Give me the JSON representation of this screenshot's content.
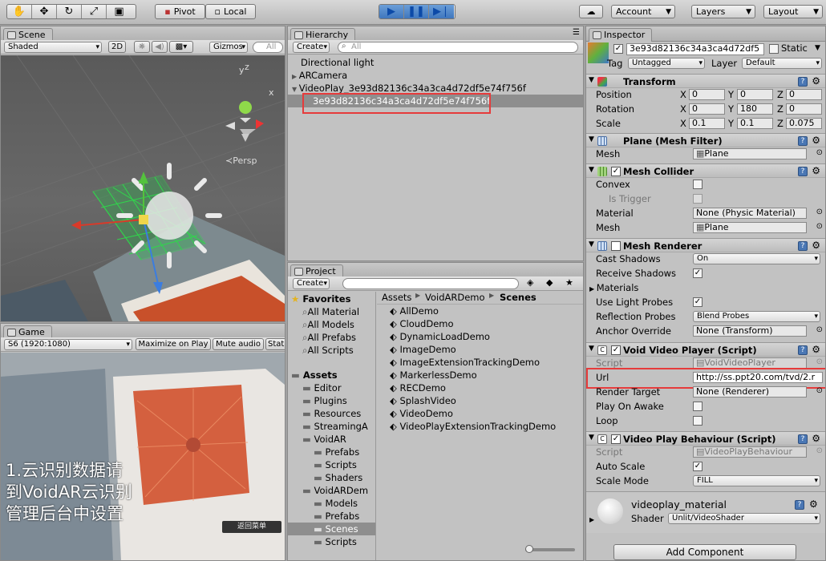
{
  "toolbar": {
    "pivot_label": "Pivot",
    "local_label": "Local",
    "account_label": "Account",
    "layers_label": "Layers",
    "layout_label": "Layout"
  },
  "scene": {
    "tab_label": "Scene",
    "shading_mode": "Shaded",
    "mode_2d": "2D",
    "gizmos_label": "Gizmos",
    "search_placeholder": "All",
    "persp_label": "Persp",
    "gizmo_y": "y",
    "gizmo_z": "z",
    "gizmo_x": "x"
  },
  "game": {
    "tab_label": "Game",
    "resolution": "S6 (1920:1080)",
    "maximize_label": "Maximize on Play",
    "mute_label": "Mute audio",
    "stats_label": "Stat",
    "overlay_line1": "1.云识别数据请",
    "overlay_line2": "到VoidAR云识别",
    "overlay_line3": "管理后台中设置",
    "phone_button": "返回菜单"
  },
  "hierarchy": {
    "tab_label": "Hierarchy",
    "create_label": "Create",
    "search_placeholder": "All",
    "items": [
      {
        "label": "Directional light"
      },
      {
        "label": "ARCamera"
      },
      {
        "label": "VideoPlay_3e93d82136c34a3ca4d72df5e74f756f"
      },
      {
        "label": "3e93d82136c34a3ca4d72df5e74f756f"
      }
    ]
  },
  "project": {
    "tab_label": "Project",
    "create_label": "Create",
    "favorites_label": "Favorites",
    "favorites": [
      {
        "label": "All Material"
      },
      {
        "label": "All Models"
      },
      {
        "label": "All Prefabs"
      },
      {
        "label": "All Scripts"
      }
    ],
    "assets_label": "Assets",
    "tree": [
      {
        "label": "Editor"
      },
      {
        "label": "Plugins"
      },
      {
        "label": "Resources"
      },
      {
        "label": "StreamingA"
      },
      {
        "label": "VoidAR"
      },
      {
        "label": "Prefabs"
      },
      {
        "label": "Scripts"
      },
      {
        "label": "Shaders"
      },
      {
        "label": "VoidARDem"
      },
      {
        "label": "Models"
      },
      {
        "label": "Prefabs"
      },
      {
        "label": "Scenes"
      },
      {
        "label": "Scripts"
      }
    ],
    "breadcrumb": [
      "Assets",
      "VoidARDemo",
      "Scenes"
    ],
    "scenes": [
      {
        "label": "AllDemo"
      },
      {
        "label": "CloudDemo"
      },
      {
        "label": "DynamicLoadDemo"
      },
      {
        "label": "ImageDemo"
      },
      {
        "label": "ImageExtensionTrackingDemo"
      },
      {
        "label": "MarkerlessDemo"
      },
      {
        "label": "RECDemo"
      },
      {
        "label": "SplashVideo"
      },
      {
        "label": "VideoDemo"
      },
      {
        "label": "VideoPlayExtensionTrackingDemo"
      }
    ]
  },
  "inspector": {
    "tab_label": "Inspector",
    "object_name": "3e93d82136c34a3ca4d72df5",
    "static_label": "Static",
    "tag_label": "Tag",
    "tag_value": "Untagged",
    "layer_label": "Layer",
    "layer_value": "Default",
    "transform": {
      "title": "Transform",
      "position_label": "Position",
      "rotation_label": "Rotation",
      "scale_label": "Scale",
      "x_label": "X",
      "y_label": "Y",
      "z_label": "Z",
      "position": [
        "0",
        "0",
        "0"
      ],
      "rotation": [
        "0",
        "180",
        "0"
      ],
      "scale": [
        "0.1",
        "0.1",
        "0.075"
      ]
    },
    "mesh_filter": {
      "title": "Plane (Mesh Filter)",
      "mesh_label": "Mesh",
      "mesh_value": "Plane"
    },
    "mesh_collider": {
      "title": "Mesh Collider",
      "convex_label": "Convex",
      "is_trigger_label": "Is Trigger",
      "material_label": "Material",
      "material_value": "None (Physic Material)",
      "mesh_label": "Mesh",
      "mesh_value": "Plane"
    },
    "mesh_renderer": {
      "title": "Mesh Renderer",
      "cast_shadows_label": "Cast Shadows",
      "cast_shadows_value": "On",
      "receive_shadows_label": "Receive Shadows",
      "materials_label": "Materials",
      "light_probes_label": "Use Light Probes",
      "reflection_probes_label": "Reflection Probes",
      "reflection_probes_value": "Blend Probes",
      "anchor_override_label": "Anchor Override",
      "anchor_override_value": "None (Transform)"
    },
    "void_video_player": {
      "title": "Void Video Player (Script)",
      "script_label": "Script",
      "script_value": "VoidVideoPlayer",
      "url_label": "Url",
      "url_value": "http://ss.ppt20.com/tvd/2.r",
      "render_target_label": "Render Target",
      "render_target_value": "None (Renderer)",
      "play_on_awake_label": "Play On Awake",
      "loop_label": "Loop"
    },
    "video_play_behaviour": {
      "title": "Video Play Behaviour (Script)",
      "script_label": "Script",
      "script_value": "VideoPlayBehaviour",
      "auto_scale_label": "Auto Scale",
      "scale_mode_label": "Scale Mode",
      "scale_mode_value": "FILL"
    },
    "material": {
      "name": "videoplay_material",
      "shader_label": "Shader",
      "shader_value": "Unlit/VideoShader"
    },
    "add_component_label": "Add Component"
  }
}
